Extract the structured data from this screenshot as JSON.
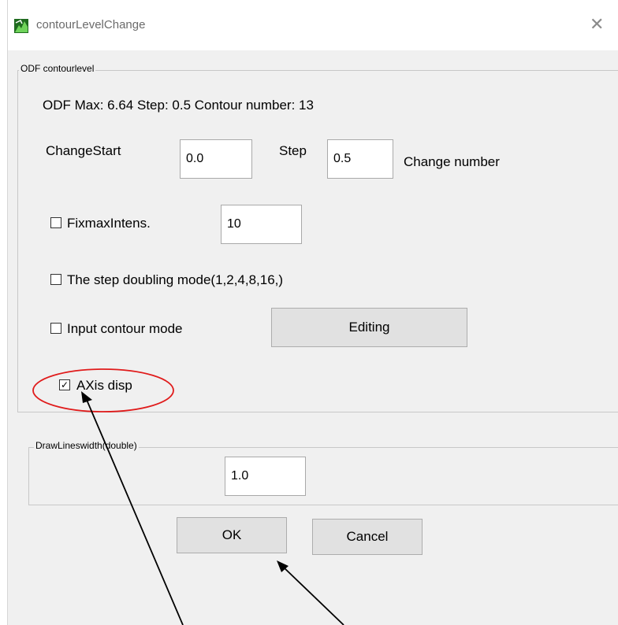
{
  "window": {
    "title": "contourLevelChange",
    "close_glyph": "✕",
    "icon": "app-icon"
  },
  "odf_group": {
    "title": "ODF contourlevel",
    "summary": "ODF Max: 6.64 Step: 0.5 Contour number: 13",
    "change_start_label": "ChangeStart",
    "change_start_value": "0.0",
    "step_label": "Step",
    "step_value": "0.5",
    "change_number_label": "Change number",
    "fix_max": {
      "label": "FixmaxIntens.",
      "checked": false,
      "value": "10"
    },
    "step_doubling": {
      "label": "The step doubling mode(1,2,4,8,16,)",
      "checked": false
    },
    "input_contour": {
      "label": "Input contour mode",
      "checked": false
    },
    "editing_button": "Editing",
    "axis_disp": {
      "label": "AXis disp",
      "checked": true,
      "check_glyph": "✓"
    }
  },
  "linewidth_group": {
    "title": "DrawLineswidth(double)",
    "value": "1.0"
  },
  "buttons": {
    "ok": "OK",
    "cancel": "Cancel"
  },
  "annotation": {
    "highlight_color": "#e01b1b",
    "arrow_color": "#000000"
  }
}
